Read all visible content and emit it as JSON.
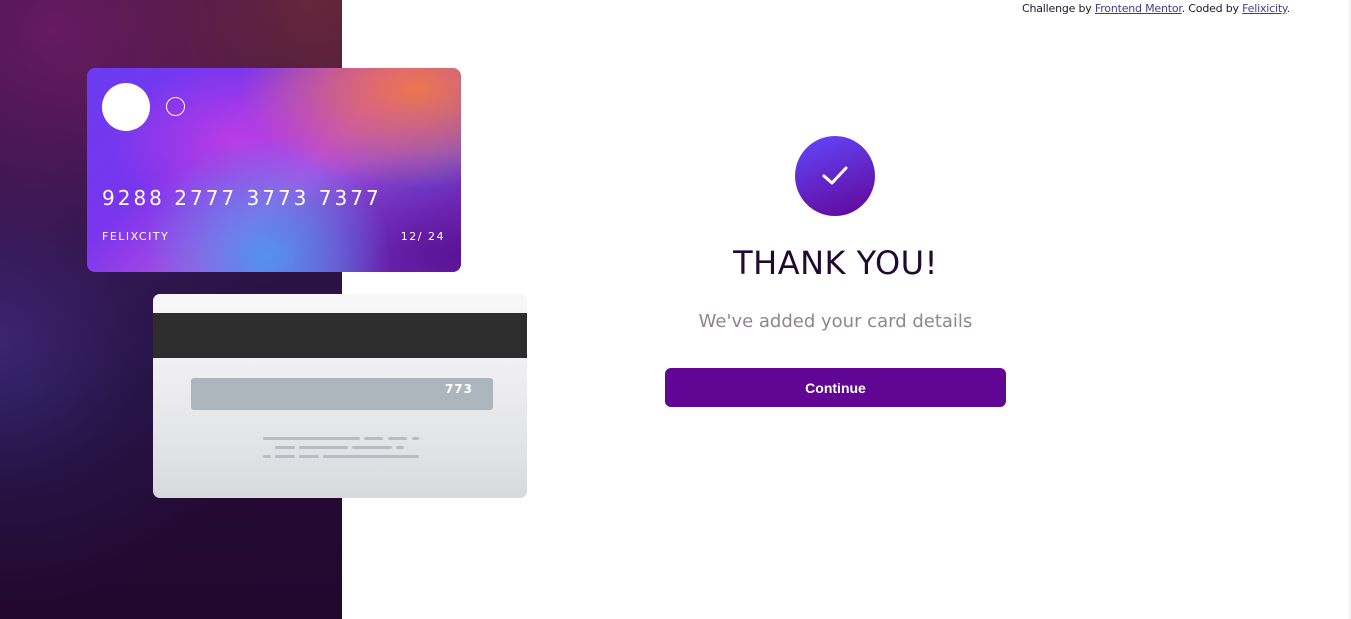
{
  "attribution": {
    "prefix": "Challenge by ",
    "challenge_link": "Frontend Mentor",
    "middle": ". Coded by ",
    "author_link": "Felixicity",
    "suffix": "."
  },
  "card_front": {
    "number": "9288 2777 3773 7377",
    "name": "FELIXCITY",
    "expiry": "12/ 24"
  },
  "card_back": {
    "cvc": "773"
  },
  "confirmation": {
    "icon": "checkmark-icon",
    "title": "THANK YOU!",
    "subtitle": "We've added your card details",
    "button_label": "Continue"
  },
  "colors": {
    "accent": "#610595",
    "title_text": "#21092f",
    "muted_text": "#8e8593",
    "magstripe": "#2d2d2d",
    "cvc_strip": "#adb5bd"
  }
}
